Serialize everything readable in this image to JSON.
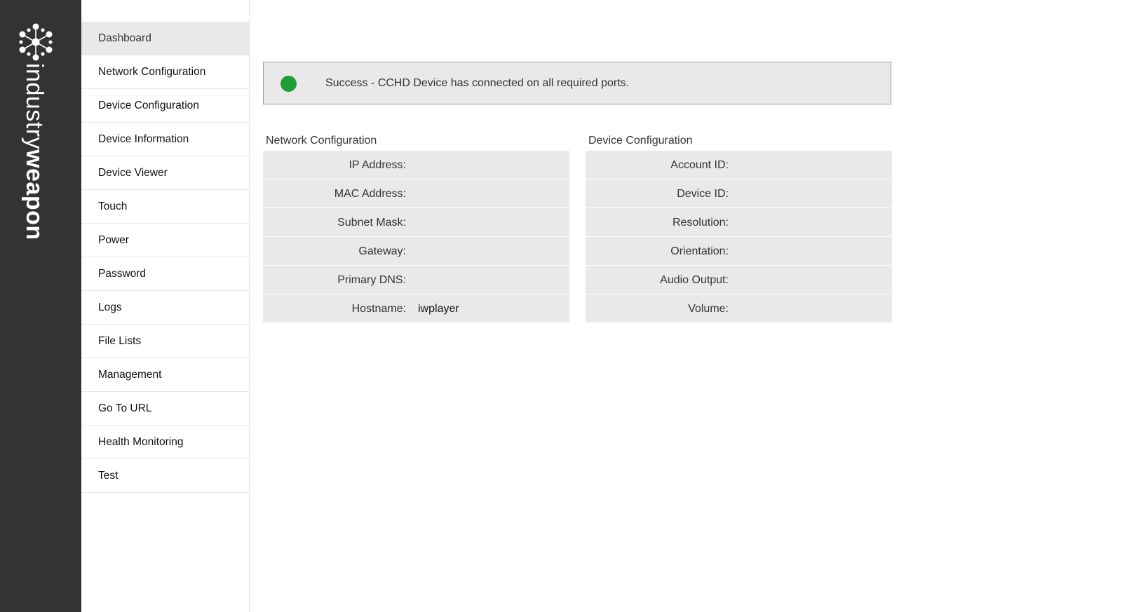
{
  "brand": {
    "logo_icon": "dot-cluster-logo-icon",
    "wordmark_light": "industry",
    "wordmark_bold": "weapon"
  },
  "nav": {
    "items": [
      {
        "label": "Dashboard",
        "active": true
      },
      {
        "label": "Network Configuration"
      },
      {
        "label": "Device Configuration"
      },
      {
        "label": "Device Information"
      },
      {
        "label": "Device Viewer"
      },
      {
        "label": "Touch"
      },
      {
        "label": "Power"
      },
      {
        "label": "Password"
      },
      {
        "label": "Logs"
      },
      {
        "label": "File Lists"
      },
      {
        "label": "Management"
      },
      {
        "label": "Go To URL"
      },
      {
        "label": "Health Monitoring"
      },
      {
        "label": "Test"
      }
    ]
  },
  "status": {
    "icon": "status-dot-icon",
    "color": "#1e9e34",
    "message": "Success - CCHD Device has connected on all required ports."
  },
  "network_panel": {
    "title": "Network Configuration",
    "rows": [
      {
        "label": "IP Address:",
        "value": ""
      },
      {
        "label": "MAC Address:",
        "value": ""
      },
      {
        "label": "Subnet Mask:",
        "value": ""
      },
      {
        "label": "Gateway:",
        "value": ""
      },
      {
        "label": "Primary DNS:",
        "value": ""
      },
      {
        "label": "Hostname:",
        "value": "iwplayer"
      }
    ]
  },
  "device_panel": {
    "title": "Device Configuration",
    "rows": [
      {
        "label": "Account ID:",
        "value": ""
      },
      {
        "label": "Device ID:",
        "value": ""
      },
      {
        "label": "Resolution:",
        "value": ""
      },
      {
        "label": "Orientation:",
        "value": ""
      },
      {
        "label": "Audio Output:",
        "value": ""
      },
      {
        "label": "Volume:",
        "value": ""
      }
    ]
  },
  "colors": {
    "brand_bar": "#333333",
    "panel_bg": "#e9e9e9",
    "success": "#1e9e34"
  }
}
